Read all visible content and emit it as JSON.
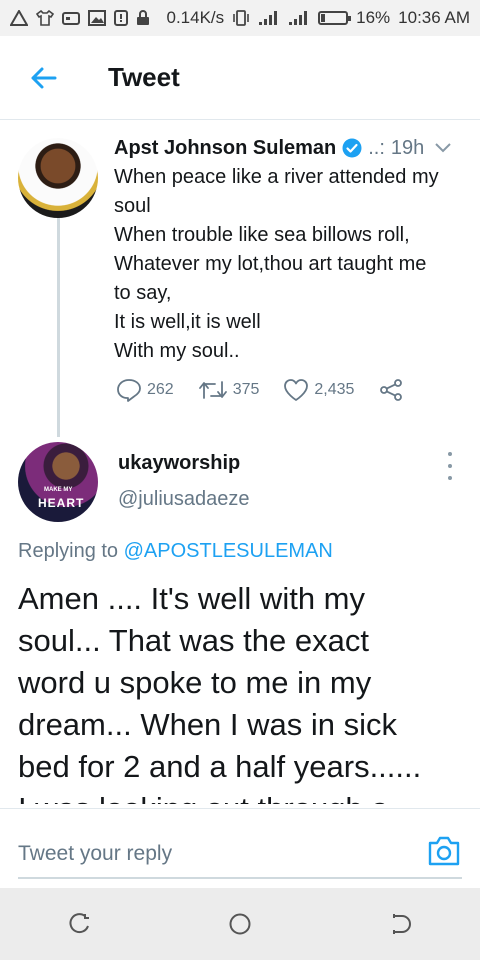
{
  "status_bar": {
    "speed": "0.14K/s",
    "battery": "16%",
    "battery_level": 0.16,
    "time": "10:36 AM"
  },
  "header": {
    "title": "Tweet"
  },
  "tweet": {
    "author": "Apst Johnson Suleman",
    "separator": "..:",
    "time": "19h",
    "lines": [
      "When peace like a river attended my",
      "soul",
      "When trouble like sea billows roll,",
      "Whatever my lot,thou art taught me",
      "to say,",
      "It is well,it is well",
      "With my soul.."
    ],
    "replies": "262",
    "retweets": "375",
    "likes": "2,435"
  },
  "reply": {
    "name": "ukayworship",
    "handle": "@juliusadaeze",
    "replying_prefix": "Replying to",
    "replying_mention": "@APOSTLESULEMAN",
    "avatar_text": "HEART",
    "lines": [
      "Amen .... It's well with my",
      "soul... That was the exact",
      "word u spoke to me in my",
      "dream... When I was in sick",
      "bed for 2 and  a half  years......",
      "I was looking  out  through a"
    ]
  },
  "composer": {
    "placeholder": "Tweet your reply"
  },
  "colors": {
    "accent": "#1da1f2",
    "text": "#14171a",
    "muted": "#657786"
  }
}
